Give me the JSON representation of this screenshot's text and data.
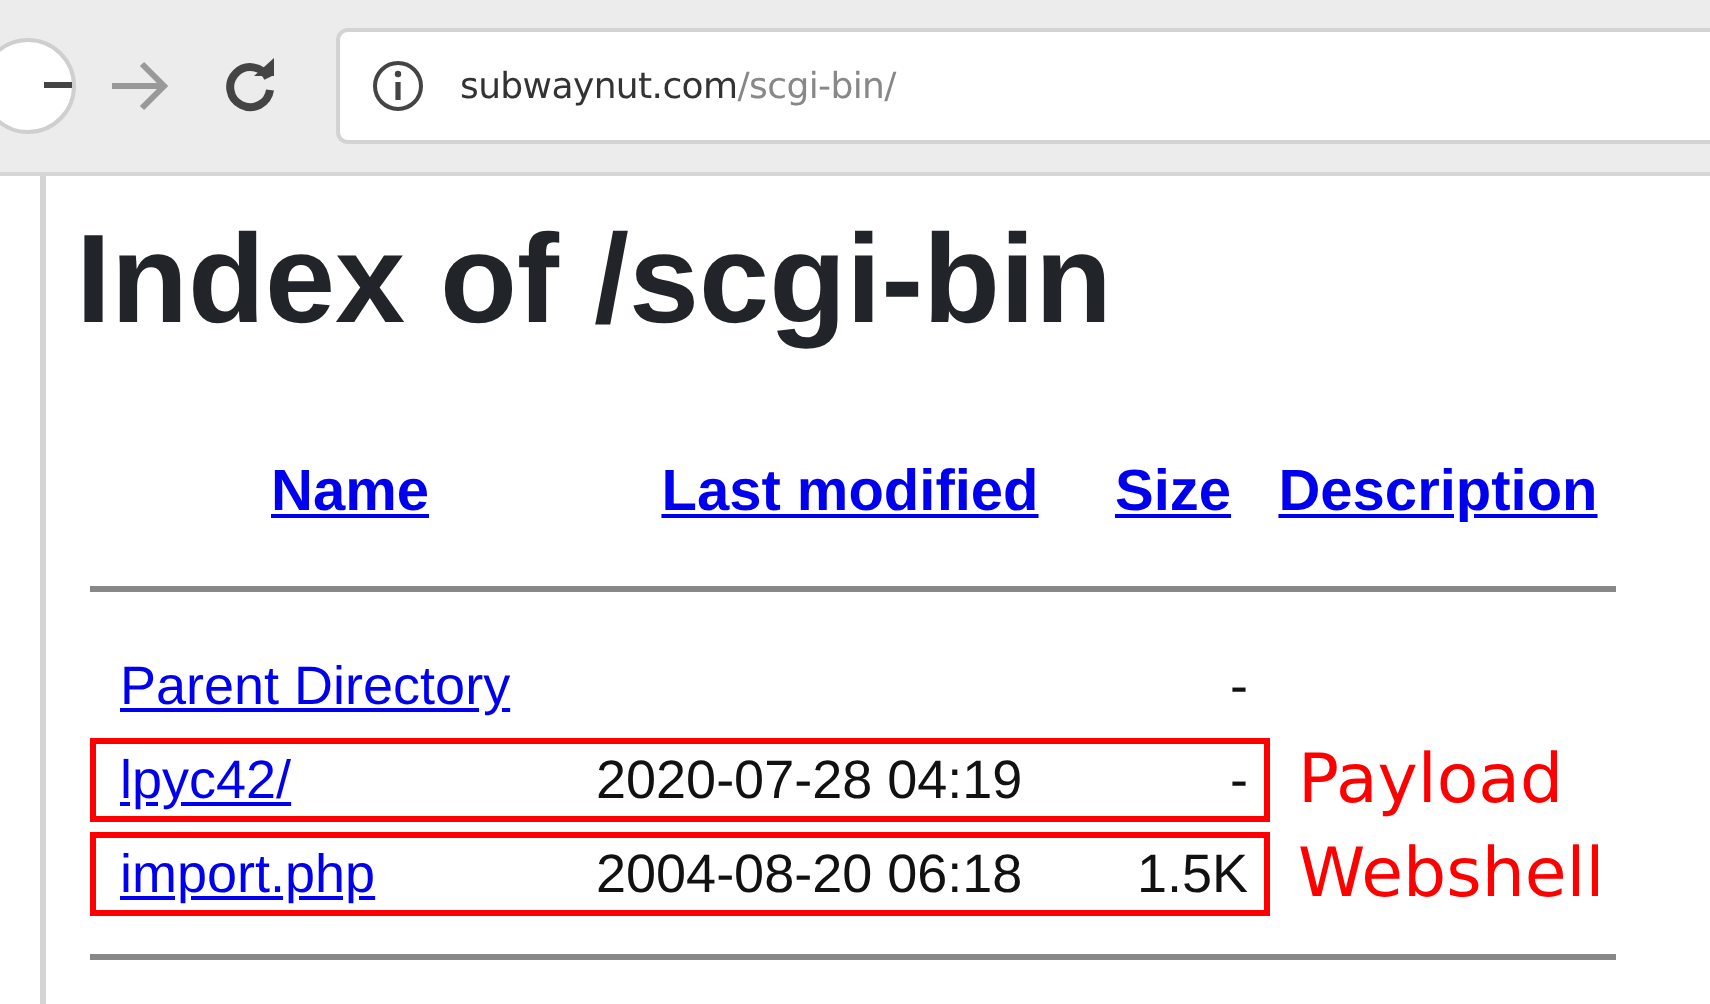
{
  "toolbar": {
    "url_host": "subwaynut.com",
    "url_path": "/scgi-bin/"
  },
  "heading": "Index of /scgi-bin",
  "columns": [
    "Name",
    "Last modified",
    "Size",
    "Description"
  ],
  "rows": [
    {
      "name": "Parent Directory",
      "size": "-"
    },
    {
      "name": "lpyc42/",
      "modified": "2020-07-28 04:19",
      "size": "-",
      "annotation": "Payload"
    },
    {
      "name": "import.php",
      "modified": "2004-08-20 06:18",
      "size": "1.5K",
      "annotation": "Webshell"
    }
  ]
}
